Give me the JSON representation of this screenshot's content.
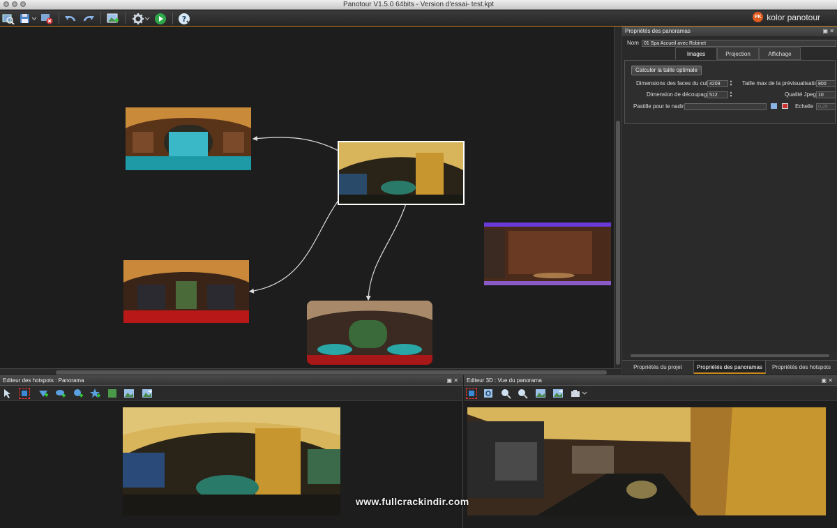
{
  "window": {
    "title": "Panotour V1.5.0 64bits - Version d'essai- test.kpt"
  },
  "brand": {
    "name": "kolor panotour",
    "mark": "PK",
    "accent": "#c98a1a"
  },
  "toolbar": {
    "icons": [
      "open-project-icon",
      "save-icon",
      "close-project-icon",
      "undo-icon",
      "redo-icon",
      "add-panorama-icon",
      "settings-icon",
      "build-play-icon",
      "help-icon"
    ]
  },
  "right_panel": {
    "header": "Propriétés des panoramas",
    "name_label": "Nom",
    "name_value": "01 Spa Accueil avec Robinet",
    "tabs": [
      "Images",
      "Projection",
      "Affichage"
    ],
    "active_tab": "Images",
    "optimal_button": "Calculer la taille optimale",
    "cube_faces_label": "Dimensions des faces du cube",
    "cube_faces_value": "4209",
    "preview_max_label": "Taille max de la prévisualisation",
    "preview_max_value": "800",
    "tiling_label": "Dimension de découpage",
    "tiling_value": "512",
    "jpeg_label": "Qualité Jpeg",
    "jpeg_value": "10",
    "nadir_label": "Pastille pour le nadir",
    "scale_label": "Echelle",
    "scale_value": "0,25",
    "bottom_tabs": [
      "Propriétés du projet",
      "Propriétés des panoramas",
      "Propriétés des hotspots"
    ],
    "active_bottom_tab": "Propriétés des panoramas"
  },
  "hotspot_editor": {
    "title": "Editeur des hotspots : Panorama",
    "tools": [
      "select-arrow-icon",
      "select-rect-icon",
      "add-polygon-hotspot-icon",
      "add-spot-hotspot-icon",
      "add-point-hotspot-icon",
      "add-star-hotspot-icon",
      "fill-icon",
      "image-hotspot-icon",
      "image-link-icon"
    ]
  },
  "view3d": {
    "title": "Editeur 3D : Vue du panorama",
    "tools": [
      "select-rect-icon",
      "zoom-fit-icon",
      "zoom-in-icon",
      "zoom-out-icon",
      "image-export-icon",
      "image-link-icon",
      "camera-icon"
    ]
  },
  "watermark": "www.fullcrackindir.com"
}
